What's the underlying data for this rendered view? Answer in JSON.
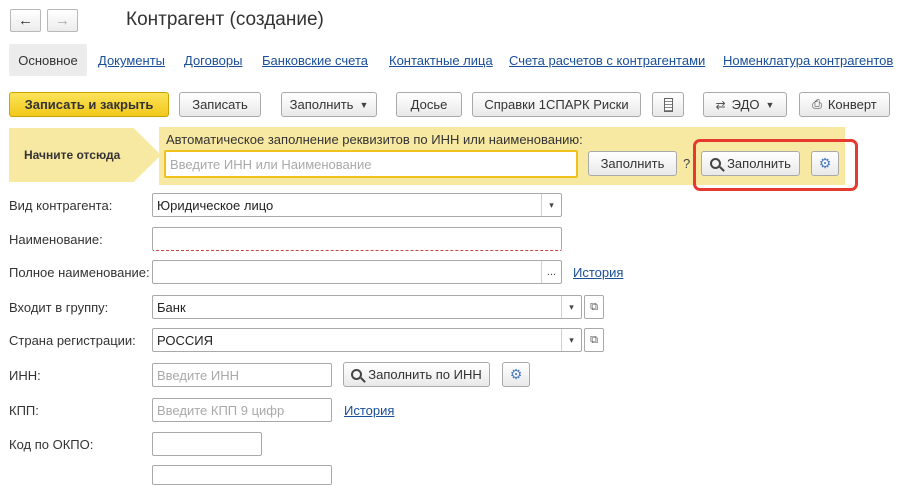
{
  "header": {
    "back_icon": "arrow-left-icon",
    "forward_icon": "arrow-right-icon",
    "title": "Контрагент (создание)"
  },
  "tabs": [
    {
      "label": "Основное",
      "active": true
    },
    {
      "label": "Документы"
    },
    {
      "label": "Договоры"
    },
    {
      "label": "Банковские счета"
    },
    {
      "label": "Контактные лица"
    },
    {
      "label": "Счета расчетов с контрагентами"
    },
    {
      "label": "Номенклатура контрагентов"
    }
  ],
  "toolbar": {
    "save_close": "Записать и закрыть",
    "save": "Записать",
    "fill": "Заполнить",
    "dossier": "Досье",
    "spark": "Справки 1СПАРК Риски",
    "edo": "ЭДО",
    "envelope": "Конверт"
  },
  "autofill": {
    "start_here": "Начните отсюда",
    "caption": "Автоматическое заполнение реквизитов по ИНН или наименованию:",
    "placeholder": "Введите ИНН или Наименование",
    "fill_button": "Заполнить",
    "help": "?",
    "fill_button2": "Заполнить"
  },
  "form": {
    "kind_label": "Вид контрагента:",
    "kind_value": "Юридическое лицо",
    "name_label": "Наименование:",
    "name_value": "",
    "full_name_label": "Полное наименование:",
    "full_name_value": "",
    "history_link": "История",
    "group_label": "Входит в группу:",
    "group_value": "Банк",
    "country_label": "Страна регистрации:",
    "country_value": "РОССИЯ",
    "inn_label": "ИНН:",
    "inn_placeholder": "Введите ИНН",
    "fill_by_inn": "Заполнить по ИНН",
    "kpp_label": "КПП:",
    "kpp_placeholder": "Введите КПП 9 цифр",
    "kpp_history": "История",
    "okpo_label": "Код по ОКПО:",
    "ellipsis": "...",
    "caret": "▾",
    "open": "⧉"
  },
  "colors": {
    "accent_yellow": "#f2c81a",
    "banner": "#f8e9a2",
    "highlight_red": "#e43a2f",
    "link": "#1a4f99"
  }
}
